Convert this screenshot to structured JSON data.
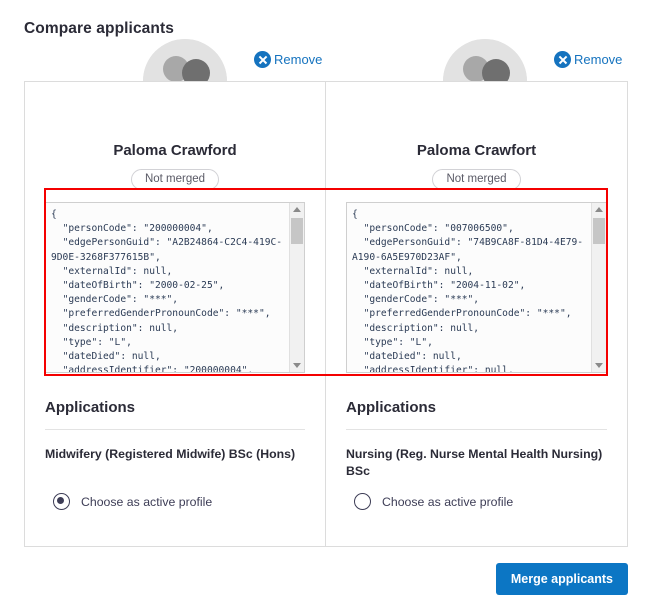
{
  "header": {
    "title": "Compare applicants"
  },
  "remove_links": [
    {
      "label": "Remove",
      "icon": "close-circle-icon"
    },
    {
      "label": "Remove",
      "icon": "close-circle-icon"
    }
  ],
  "applicants": [
    {
      "name": "Paloma Crawford",
      "merge_status": "Not merged",
      "avatar_icon": "two-people-avatar-icon",
      "json": "{\n  \"personCode\": \"200000004\",\n  \"edgePersonGuid\": \"A2B24864-C2C4-419C-9D0E-3268F377615B\",\n  \"externalId\": null,\n  \"dateOfBirth\": \"2000-02-25\",\n  \"genderCode\": \"***\",\n  \"preferredGenderPronounCode\": \"***\",\n  \"description\": null,\n  \"type\": \"L\",\n  \"dateDied\": null,\n  \"addressIdentifier\": \"200000004\",",
      "applications_title": "Applications",
      "applications": [
        "Midwifery (Registered Midwife) BSc (Hons)"
      ],
      "radio_label": "Choose as active profile",
      "radio_selected": true
    },
    {
      "name": "Paloma Crawfort",
      "merge_status": "Not merged",
      "avatar_icon": "two-people-avatar-icon",
      "json": "{\n  \"personCode\": \"007006500\",\n  \"edgePersonGuid\": \"74B9CA8F-81D4-4E79-A190-6A5E970D23AF\",\n  \"externalId\": null,\n  \"dateOfBirth\": \"2004-11-02\",\n  \"genderCode\": \"***\",\n  \"preferredGenderPronounCode\": \"***\",\n  \"description\": null,\n  \"type\": \"L\",\n  \"dateDied\": null,\n  \"addressIdentifier\": null,",
      "applications_title": "Applications",
      "applications": [
        "Nursing (Reg. Nurse Mental Health Nursing) BSc"
      ],
      "radio_label": "Choose as active profile",
      "radio_selected": false
    }
  ],
  "footer": {
    "merge_button_label": "Merge applicants"
  },
  "colors": {
    "accent_blue": "#0c76c4",
    "link_blue": "#1573bf",
    "highlight_red": "#f40000",
    "text_dark": "#2b2b37"
  }
}
